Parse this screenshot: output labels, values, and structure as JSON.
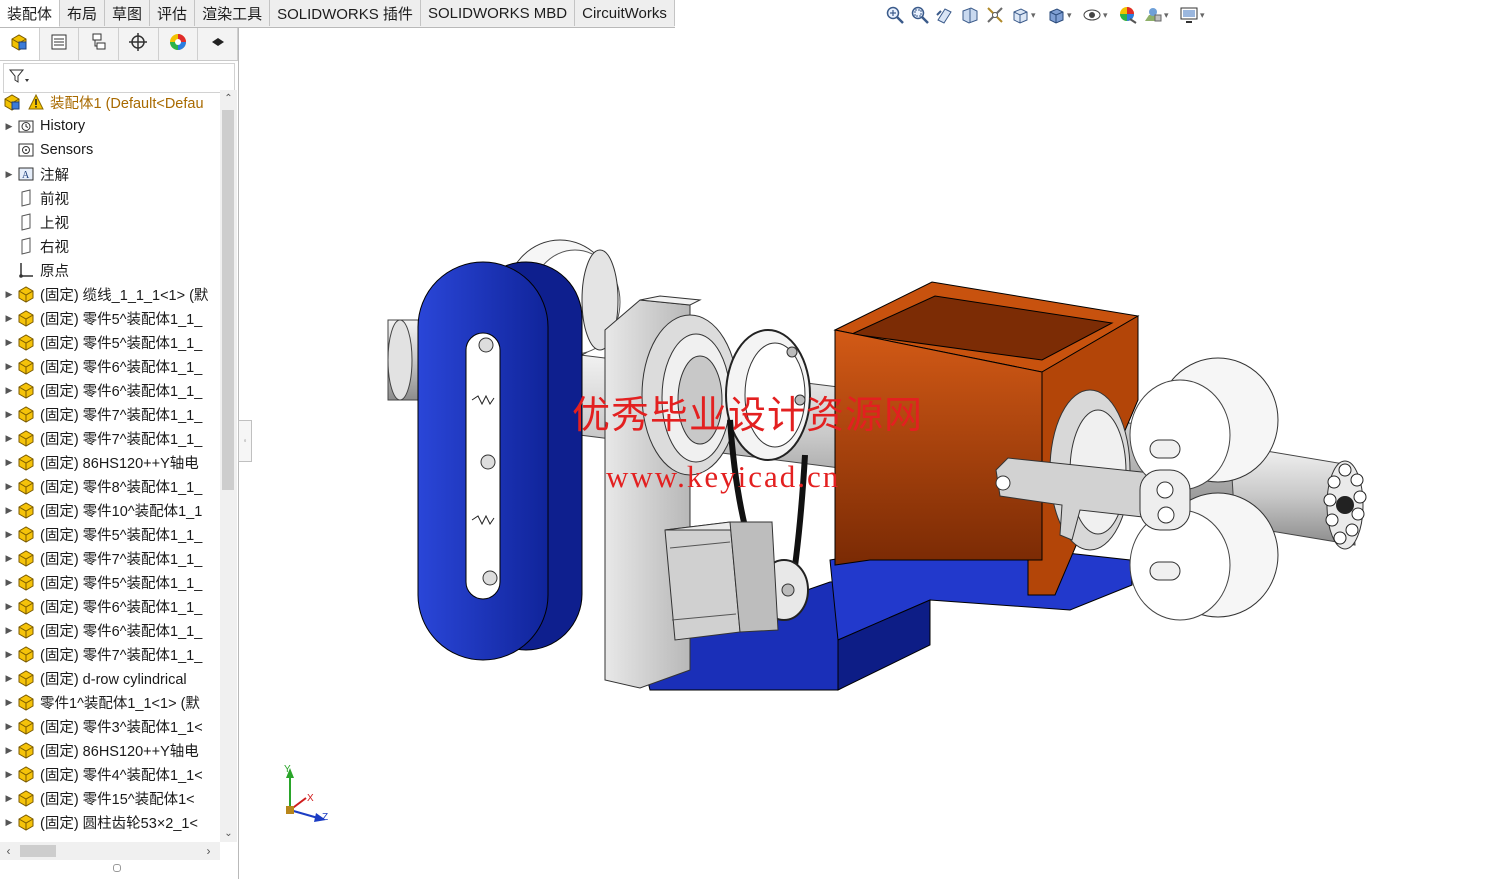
{
  "command_tabs": [
    {
      "label": "装配体",
      "active": true
    },
    {
      "label": "布局",
      "active": false
    },
    {
      "label": "草图",
      "active": false
    },
    {
      "label": "评估",
      "active": false
    },
    {
      "label": "渲染工具",
      "active": false
    },
    {
      "label": "SOLIDWORKS 插件",
      "active": false
    },
    {
      "label": "SOLIDWORKS MBD",
      "active": false
    },
    {
      "label": "CircuitWorks",
      "active": false
    }
  ],
  "view_toolbar_icons": [
    "zoom-to-fit-icon",
    "zoom-to-area-icon",
    "previous-view-icon",
    "section-view-icon",
    "dynamic-annotation-icon",
    "view-orientation-icon",
    "display-style-icon",
    "hide-show-icon",
    "edit-appearance-icon",
    "apply-scene-icon",
    "view-settings-icon"
  ],
  "manager_tabs": [
    "featuremanager-icon",
    "propertymanager-icon",
    "configurationmanager-icon",
    "dimxpert-icon",
    "display-manager-icon",
    "more-icon"
  ],
  "tree": {
    "root": "装配体1  (Default<Defau",
    "items": [
      {
        "label": "History",
        "icon": "history-icon",
        "expandable": true
      },
      {
        "label": "Sensors",
        "icon": "sensors-icon",
        "expandable": false
      },
      {
        "label": "注解",
        "icon": "annotations-icon",
        "expandable": true
      },
      {
        "label": "前视",
        "icon": "plane-icon",
        "expandable": false
      },
      {
        "label": "上视",
        "icon": "plane-icon",
        "expandable": false
      },
      {
        "label": "右视",
        "icon": "plane-icon",
        "expandable": false
      },
      {
        "label": "原点",
        "icon": "origin-icon",
        "expandable": false
      },
      {
        "label": "(固定) 缆线_1_1_1<1> (默",
        "icon": "part-icon",
        "expandable": true
      },
      {
        "label": "(固定) 零件5^装配体1_1_",
        "icon": "part-icon",
        "expandable": true
      },
      {
        "label": "(固定) 零件5^装配体1_1_",
        "icon": "part-icon",
        "expandable": true
      },
      {
        "label": "(固定) 零件6^装配体1_1_",
        "icon": "part-icon",
        "expandable": true
      },
      {
        "label": "(固定) 零件6^装配体1_1_",
        "icon": "part-icon",
        "expandable": true
      },
      {
        "label": "(固定) 零件7^装配体1_1_",
        "icon": "part-icon",
        "expandable": true
      },
      {
        "label": "(固定) 零件7^装配体1_1_",
        "icon": "part-icon",
        "expandable": true
      },
      {
        "label": "(固定) 86HS120++Y轴电",
        "icon": "part-icon",
        "expandable": true
      },
      {
        "label": "(固定) 零件8^装配体1_1_",
        "icon": "part-icon",
        "expandable": true
      },
      {
        "label": "(固定) 零件10^装配体1_1",
        "icon": "part-icon",
        "expandable": true
      },
      {
        "label": "(固定) 零件5^装配体1_1_",
        "icon": "part-icon",
        "expandable": true
      },
      {
        "label": "(固定) 零件7^装配体1_1_",
        "icon": "part-icon",
        "expandable": true
      },
      {
        "label": "(固定) 零件5^装配体1_1_",
        "icon": "part-icon",
        "expandable": true
      },
      {
        "label": "(固定) 零件6^装配体1_1_",
        "icon": "part-icon",
        "expandable": true
      },
      {
        "label": "(固定) 零件6^装配体1_1_",
        "icon": "part-icon",
        "expandable": true
      },
      {
        "label": "(固定) 零件7^装配体1_1_",
        "icon": "part-icon",
        "expandable": true
      },
      {
        "label": "(固定) d-row cylindrical",
        "icon": "part-icon",
        "expandable": true
      },
      {
        "label": "零件1^装配体1_1<1> (默",
        "icon": "part-icon",
        "expandable": true
      },
      {
        "label": "(固定) 零件3^装配体1_1<",
        "icon": "part-icon",
        "expandable": true
      },
      {
        "label": "(固定) 86HS120++Y轴电",
        "icon": "part-icon",
        "expandable": true
      },
      {
        "label": "(固定) 零件4^装配体1_1<",
        "icon": "part-icon",
        "expandable": true
      },
      {
        "label": "(固定) 零件15^装配体1<",
        "icon": "part-icon",
        "expandable": true
      },
      {
        "label": "(固定) 圆柱齿轮53×2_1<",
        "icon": "part-icon",
        "expandable": true
      }
    ]
  },
  "watermark": {
    "line1": "优秀毕业设计资源网",
    "line2": "www.keyicad.cn"
  },
  "triad": {
    "x": "X",
    "y": "Y",
    "z": "Z"
  },
  "colors": {
    "blue_part": "#1c34c4",
    "orange_part": "#c24a0a",
    "gray_part": "#d4d4d4",
    "root_text": "#a86a00",
    "watermark": "#e32020"
  }
}
